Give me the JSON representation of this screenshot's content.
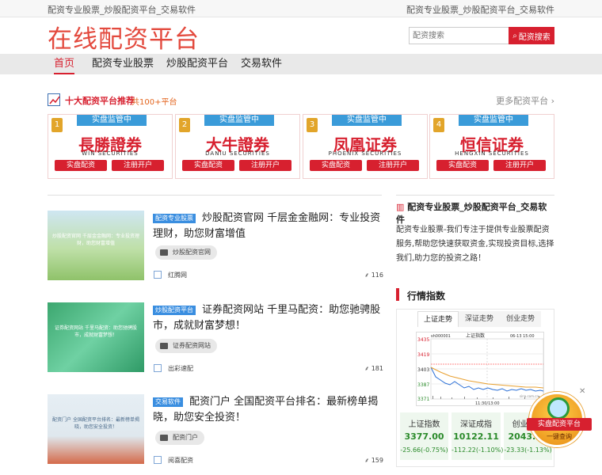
{
  "topbar": {
    "left": "配资专业股票_炒股配资平台_交易软件",
    "right": "配资专业股票_炒股配资平台_交易软件"
  },
  "logo": "在线配资平台",
  "search": {
    "placeholder": "配资搜索",
    "button": "配资搜索"
  },
  "nav": {
    "items": [
      "首页",
      "配资专业股票",
      "炒股配资平台",
      "交易软件"
    ]
  },
  "brokers_section": {
    "title": "十大配资平台推荐",
    "count": "共100+平台",
    "more": "更多配资平台"
  },
  "brokers": [
    {
      "rank": "1",
      "badge": "实盘监管中",
      "name": "長勝證券",
      "en": "WIN SECURITIES",
      "btn1": "实盘配资",
      "btn2": "注册开户"
    },
    {
      "rank": "2",
      "badge": "实盘监管中",
      "name": "大牛證券",
      "en": "DANIU SECURITIES",
      "btn1": "实盘配资",
      "btn2": "注册开户"
    },
    {
      "rank": "3",
      "badge": "实盘监管中",
      "name": "凤凰证券",
      "en": "PHOENIX SECURITIES",
      "btn1": "实盘配资",
      "btn2": "注册开户"
    },
    {
      "rank": "4",
      "badge": "实盘监管中",
      "name": "恒信证券",
      "en": "HENGXIN SECURITIES",
      "btn1": "实盘配资",
      "btn2": "注册开户"
    }
  ],
  "articles": [
    {
      "tag": "配资专业股票",
      "title": "炒股配资官网 千层金金融网：专业投资理财，助您财富增值",
      "chip": "炒股配资官网",
      "source": "红腾网",
      "views": "116",
      "thumb_caption": "炒股配资官网 千层金金融网：专业投资理财，助您财富增值"
    },
    {
      "tag": "炒股配资平台",
      "title": "证券配资网站 千里马配资：助您驰骋股市，成就财富梦想！",
      "chip": "证券配资网站",
      "source": "出彩速配",
      "views": "181",
      "thumb_caption": "证券配资网站 千里马配资：助您驰骋股市，成就财富梦想！"
    },
    {
      "tag": "交易软件",
      "title": "配资门户 全国配资平台排名：最新榜单揭晓，助您安全投资！",
      "chip": "配资门户",
      "source": "阅喜配资",
      "views": "159",
      "thumb_caption": "配资门户 全国配资平台排名：最新榜单揭晓，助您安全投资！"
    }
  ],
  "sidebar": {
    "title": "配资专业股票_炒股配资平台_交易软件",
    "desc": "配资专业股票-我们专注于提供专业股票配资服务,帮助您快速获取资金,实现投资目标,选择我们,助力您的投资之路！",
    "market_title": "行情指数",
    "tabs": [
      "上证走势",
      "深证走势",
      "创业走势"
    ],
    "chart_label": "上证指数",
    "chart_code": "sh000001",
    "chart_date": "06-13 15:00",
    "chart_y": [
      "3435",
      "3419",
      "3403",
      "3387",
      "3371"
    ],
    "chart_x": [
      "11:30/13:00"
    ],
    "chart_site": "sina.com.cn",
    "quotes": [
      {
        "name": "上证指数",
        "value": "3377.00",
        "change": "-25.66(-0.75%)"
      },
      {
        "name": "深证成指",
        "value": "10122.11",
        "change": "-112.22(-1.10%)"
      },
      {
        "name": "创业板指",
        "value": "2043.81",
        "change": "-23.33(-1.13%)"
      }
    ]
  },
  "float": {
    "title": "实盘配资平台",
    "sub": "一键查询",
    "close": "✕"
  }
}
